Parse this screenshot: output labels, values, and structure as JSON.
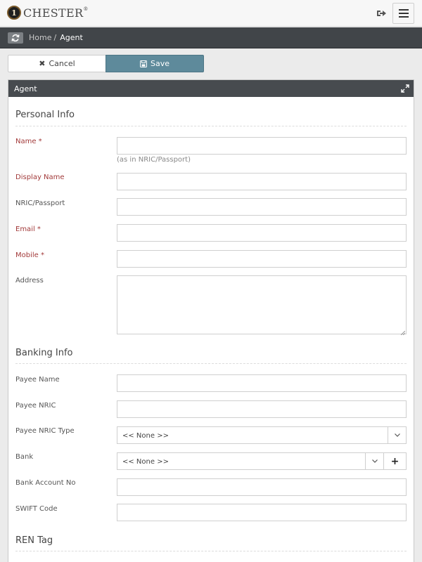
{
  "header": {
    "logo_mark": "1",
    "logo_text": "CHESTER",
    "logo_reg": "®"
  },
  "breadcrumb": {
    "home": "Home",
    "separator": "/",
    "current": "Agent"
  },
  "actions": {
    "cancel_label": "Cancel",
    "save_label": "Save"
  },
  "panel": {
    "title": "Agent"
  },
  "personal_info": {
    "title": "Personal Info",
    "name_label": "Name *",
    "name_value": "",
    "name_hint": "(as in NRIC/Passport)",
    "display_name_label": "Display Name",
    "display_name_value": "",
    "nric_label": "NRIC/Passport",
    "nric_value": "",
    "email_label": "Email *",
    "email_value": "",
    "mobile_label": "Mobile *",
    "mobile_value": "",
    "address_label": "Address",
    "address_value": ""
  },
  "banking_info": {
    "title": "Banking Info",
    "payee_name_label": "Payee Name",
    "payee_name_value": "",
    "payee_nric_label": "Payee NRIC",
    "payee_nric_value": "",
    "payee_nric_type_label": "Payee NRIC Type",
    "payee_nric_type_value": "<< None >>",
    "bank_label": "Bank",
    "bank_value": "<< None >>",
    "bank_add_label": "+",
    "bank_account_label": "Bank Account No",
    "bank_account_value": "",
    "swift_label": "SWIFT Code",
    "swift_value": ""
  },
  "ren_tag": {
    "title": "REN Tag"
  },
  "colors": {
    "accent_save": "#5e8a9b",
    "required_label": "#a23a3a",
    "header_dark": "#414549"
  },
  "icons": {
    "logout": "logout-icon",
    "menu": "hamburger-menu-icon",
    "refresh": "refresh-icon",
    "cancel": "close-icon",
    "save": "floppy-disk-icon",
    "expand": "expand-icon",
    "caret": "chevron-down-icon",
    "add": "plus-icon"
  }
}
